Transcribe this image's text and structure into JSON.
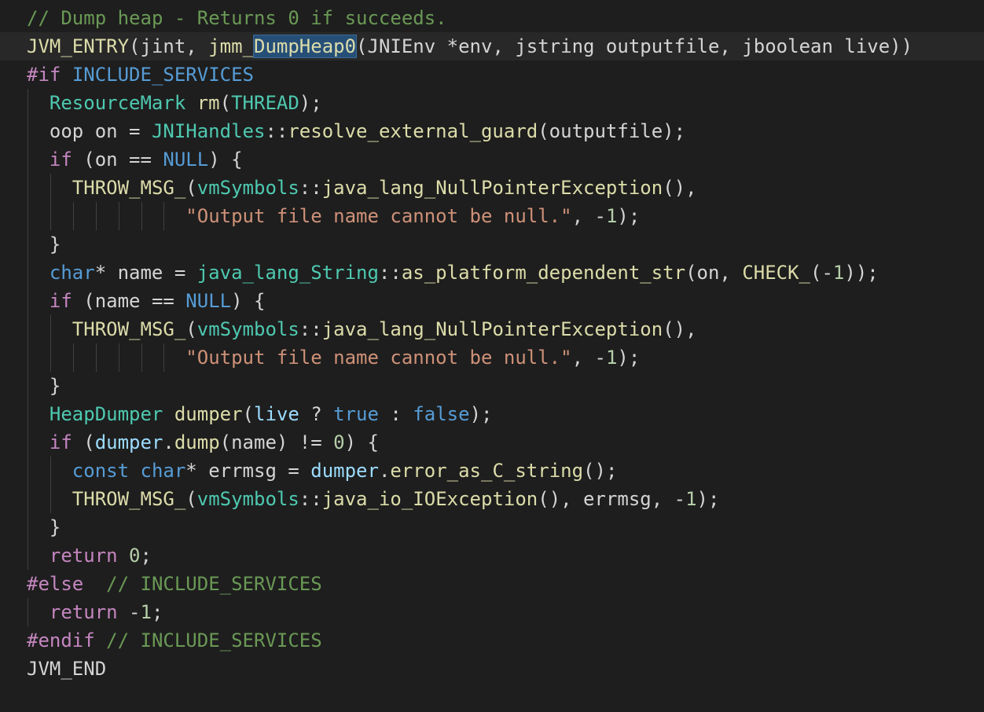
{
  "editor": {
    "language": "C++",
    "theme": "Dark+",
    "colors": {
      "background": "#1e1e1e",
      "comment": "#6a9955",
      "keyword": "#569cd6",
      "control": "#c586c0",
      "type": "#4ec9b0",
      "function": "#dcdcaa",
      "variable": "#9cdcfe",
      "string": "#ce9178",
      "number": "#b5cea8",
      "text": "#d4d4d4",
      "selection_highlight": "#264f78"
    },
    "highlighted_word": "DumpHeap0",
    "lines": [
      {
        "indent": 0,
        "tokens": [
          {
            "t": "// Dump heap - Returns 0 if succeeds.",
            "c": "comment"
          }
        ]
      },
      {
        "indent": 0,
        "current": true,
        "tokens": [
          {
            "t": "JVM_ENTRY",
            "c": "func"
          },
          {
            "t": "(jint, ",
            "c": "plain"
          },
          {
            "t": "jmm_",
            "c": "func"
          },
          {
            "t": "DumpHeap0",
            "c": "func",
            "hl": true
          },
          {
            "t": "(JNIEnv *env, jstring outputfile, jboolean live))",
            "c": "plain"
          }
        ]
      },
      {
        "indent": 0,
        "tokens": [
          {
            "t": "#if",
            "c": "control"
          },
          {
            "t": " ",
            "c": "plain"
          },
          {
            "t": "INCLUDE_SERVICES",
            "c": "keyword"
          }
        ]
      },
      {
        "indent": 1,
        "tokens": [
          {
            "t": "ResourceMark",
            "c": "type"
          },
          {
            "t": " ",
            "c": "plain"
          },
          {
            "t": "rm",
            "c": "func"
          },
          {
            "t": "(",
            "c": "plain"
          },
          {
            "t": "THREAD",
            "c": "type"
          },
          {
            "t": ");",
            "c": "plain"
          }
        ]
      },
      {
        "indent": 1,
        "tokens": [
          {
            "t": "oop on = ",
            "c": "plain"
          },
          {
            "t": "JNIHandles",
            "c": "type"
          },
          {
            "t": "::",
            "c": "plain"
          },
          {
            "t": "resolve_external_guard",
            "c": "func"
          },
          {
            "t": "(outputfile);",
            "c": "plain"
          }
        ]
      },
      {
        "indent": 1,
        "tokens": [
          {
            "t": "if",
            "c": "control"
          },
          {
            "t": " (on == ",
            "c": "plain"
          },
          {
            "t": "NULL",
            "c": "keyword"
          },
          {
            "t": ") {",
            "c": "plain"
          }
        ]
      },
      {
        "indent": 2,
        "tokens": [
          {
            "t": "THROW_MSG_",
            "c": "func"
          },
          {
            "t": "(",
            "c": "plain"
          },
          {
            "t": "vmSymbols",
            "c": "type"
          },
          {
            "t": "::",
            "c": "plain"
          },
          {
            "t": "java_lang_NullPointerException",
            "c": "func"
          },
          {
            "t": "(),",
            "c": "plain"
          }
        ]
      },
      {
        "indent": 7,
        "tokens": [
          {
            "t": "\"Output file name cannot be null.\"",
            "c": "string"
          },
          {
            "t": ", -",
            "c": "plain"
          },
          {
            "t": "1",
            "c": "number"
          },
          {
            "t": ");",
            "c": "plain"
          }
        ]
      },
      {
        "indent": 1,
        "tokens": [
          {
            "t": "}",
            "c": "plain"
          }
        ]
      },
      {
        "indent": 1,
        "tokens": [
          {
            "t": "char",
            "c": "keyword"
          },
          {
            "t": "* name = ",
            "c": "plain"
          },
          {
            "t": "java_lang_String",
            "c": "type"
          },
          {
            "t": "::",
            "c": "plain"
          },
          {
            "t": "as_platform_dependent_str",
            "c": "func"
          },
          {
            "t": "(on, ",
            "c": "plain"
          },
          {
            "t": "CHECK_",
            "c": "func"
          },
          {
            "t": "(-",
            "c": "plain"
          },
          {
            "t": "1",
            "c": "number"
          },
          {
            "t": "));",
            "c": "plain"
          }
        ]
      },
      {
        "indent": 1,
        "tokens": [
          {
            "t": "if",
            "c": "control"
          },
          {
            "t": " (name == ",
            "c": "plain"
          },
          {
            "t": "NULL",
            "c": "keyword"
          },
          {
            "t": ") {",
            "c": "plain"
          }
        ]
      },
      {
        "indent": 2,
        "tokens": [
          {
            "t": "THROW_MSG_",
            "c": "func"
          },
          {
            "t": "(",
            "c": "plain"
          },
          {
            "t": "vmSymbols",
            "c": "type"
          },
          {
            "t": "::",
            "c": "plain"
          },
          {
            "t": "java_lang_NullPointerException",
            "c": "func"
          },
          {
            "t": "(),",
            "c": "plain"
          }
        ]
      },
      {
        "indent": 7,
        "tokens": [
          {
            "t": "\"Output file name cannot be null.\"",
            "c": "string"
          },
          {
            "t": ", -",
            "c": "plain"
          },
          {
            "t": "1",
            "c": "number"
          },
          {
            "t": ");",
            "c": "plain"
          }
        ]
      },
      {
        "indent": 1,
        "tokens": [
          {
            "t": "}",
            "c": "plain"
          }
        ]
      },
      {
        "indent": 1,
        "tokens": [
          {
            "t": "HeapDumper",
            "c": "type"
          },
          {
            "t": " ",
            "c": "plain"
          },
          {
            "t": "dumper",
            "c": "func"
          },
          {
            "t": "(",
            "c": "plain"
          },
          {
            "t": "live",
            "c": "var"
          },
          {
            "t": " ? ",
            "c": "plain"
          },
          {
            "t": "true",
            "c": "keyword"
          },
          {
            "t": " : ",
            "c": "plain"
          },
          {
            "t": "false",
            "c": "keyword"
          },
          {
            "t": ");",
            "c": "plain"
          }
        ]
      },
      {
        "indent": 1,
        "tokens": [
          {
            "t": "if",
            "c": "control"
          },
          {
            "t": " (",
            "c": "plain"
          },
          {
            "t": "dumper",
            "c": "var"
          },
          {
            "t": ".",
            "c": "plain"
          },
          {
            "t": "dump",
            "c": "func"
          },
          {
            "t": "(name) != ",
            "c": "plain"
          },
          {
            "t": "0",
            "c": "number"
          },
          {
            "t": ") {",
            "c": "plain"
          }
        ]
      },
      {
        "indent": 2,
        "tokens": [
          {
            "t": "const",
            "c": "keyword"
          },
          {
            "t": " ",
            "c": "plain"
          },
          {
            "t": "char",
            "c": "keyword"
          },
          {
            "t": "* errmsg = ",
            "c": "plain"
          },
          {
            "t": "dumper",
            "c": "var"
          },
          {
            "t": ".",
            "c": "plain"
          },
          {
            "t": "error_as_C_string",
            "c": "func"
          },
          {
            "t": "();",
            "c": "plain"
          }
        ]
      },
      {
        "indent": 2,
        "tokens": [
          {
            "t": "THROW_MSG_",
            "c": "func"
          },
          {
            "t": "(",
            "c": "plain"
          },
          {
            "t": "vmSymbols",
            "c": "type"
          },
          {
            "t": "::",
            "c": "plain"
          },
          {
            "t": "java_io_IOException",
            "c": "func"
          },
          {
            "t": "(), errmsg, -",
            "c": "plain"
          },
          {
            "t": "1",
            "c": "number"
          },
          {
            "t": ");",
            "c": "plain"
          }
        ]
      },
      {
        "indent": 1,
        "tokens": [
          {
            "t": "}",
            "c": "plain"
          }
        ]
      },
      {
        "indent": 1,
        "tokens": [
          {
            "t": "return",
            "c": "control"
          },
          {
            "t": " ",
            "c": "plain"
          },
          {
            "t": "0",
            "c": "number"
          },
          {
            "t": ";",
            "c": "plain"
          }
        ]
      },
      {
        "indent": 0,
        "tokens": [
          {
            "t": "#else",
            "c": "control"
          },
          {
            "t": "  ",
            "c": "plain"
          },
          {
            "t": "// INCLUDE_SERVICES",
            "c": "comment"
          }
        ]
      },
      {
        "indent": 1,
        "tokens": [
          {
            "t": "return",
            "c": "control"
          },
          {
            "t": " -",
            "c": "plain"
          },
          {
            "t": "1",
            "c": "number"
          },
          {
            "t": ";",
            "c": "plain"
          }
        ]
      },
      {
        "indent": 0,
        "tokens": [
          {
            "t": "#endif",
            "c": "control"
          },
          {
            "t": " ",
            "c": "plain"
          },
          {
            "t": "// INCLUDE_SERVICES",
            "c": "comment"
          }
        ]
      },
      {
        "indent": 0,
        "tokens": [
          {
            "t": "JVM_END",
            "c": "plain"
          }
        ]
      }
    ]
  }
}
